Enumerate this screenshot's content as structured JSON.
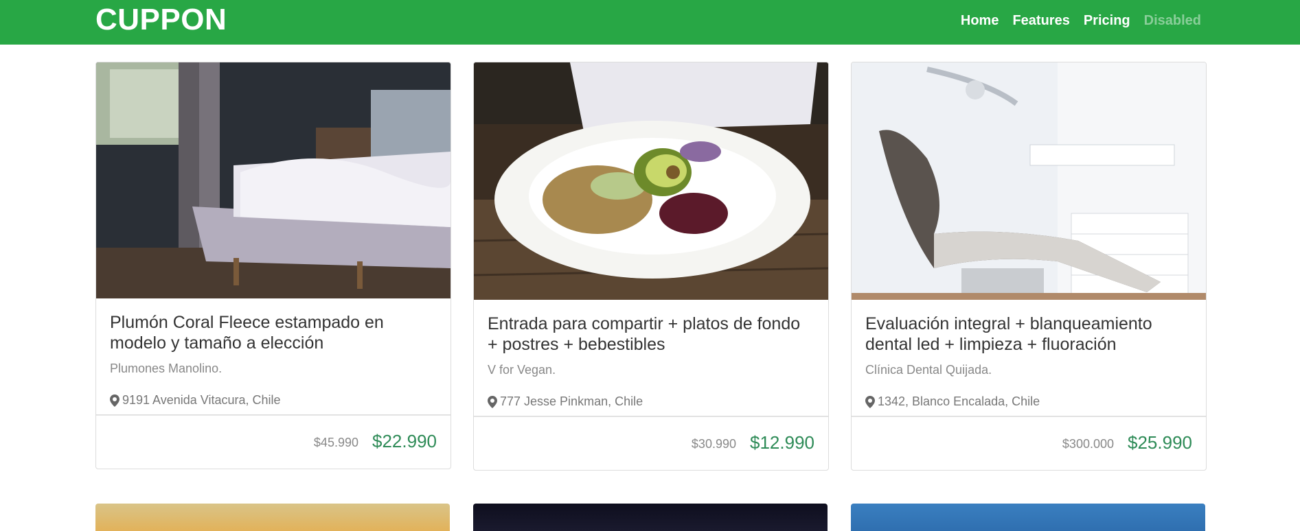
{
  "nav": {
    "brand": "CUPPON",
    "links": [
      {
        "label": "Home",
        "disabled": false
      },
      {
        "label": "Features",
        "disabled": false
      },
      {
        "label": "Pricing",
        "disabled": false
      },
      {
        "label": "Disabled",
        "disabled": true
      }
    ]
  },
  "deals": [
    {
      "title": "Plumón Coral Fleece estampado en modelo y tamaño a elección",
      "vendor": "Plumones Manolino.",
      "location": "9191 Avenida Vitacura, Chile",
      "old_price": "$45.990",
      "new_price": "$22.990"
    },
    {
      "title": "Entrada para compartir + platos de fondo + postres + bebestibles",
      "vendor": "V for Vegan.",
      "location": "777 Jesse Pinkman, Chile",
      "old_price": "$30.990",
      "new_price": "$12.990"
    },
    {
      "title": "Evaluación integral + blanqueamiento dental led + limpieza + fluoración",
      "vendor": "Clínica Dental Quijada.",
      "location": "1342, Blanco Encalada, Chile",
      "old_price": "$300.000",
      "new_price": "$25.990"
    }
  ],
  "colors": {
    "navbar": "#28a745",
    "price_new": "#2e8b57",
    "price_old": "#888888"
  },
  "icons": {
    "location": "map-marker-icon"
  }
}
